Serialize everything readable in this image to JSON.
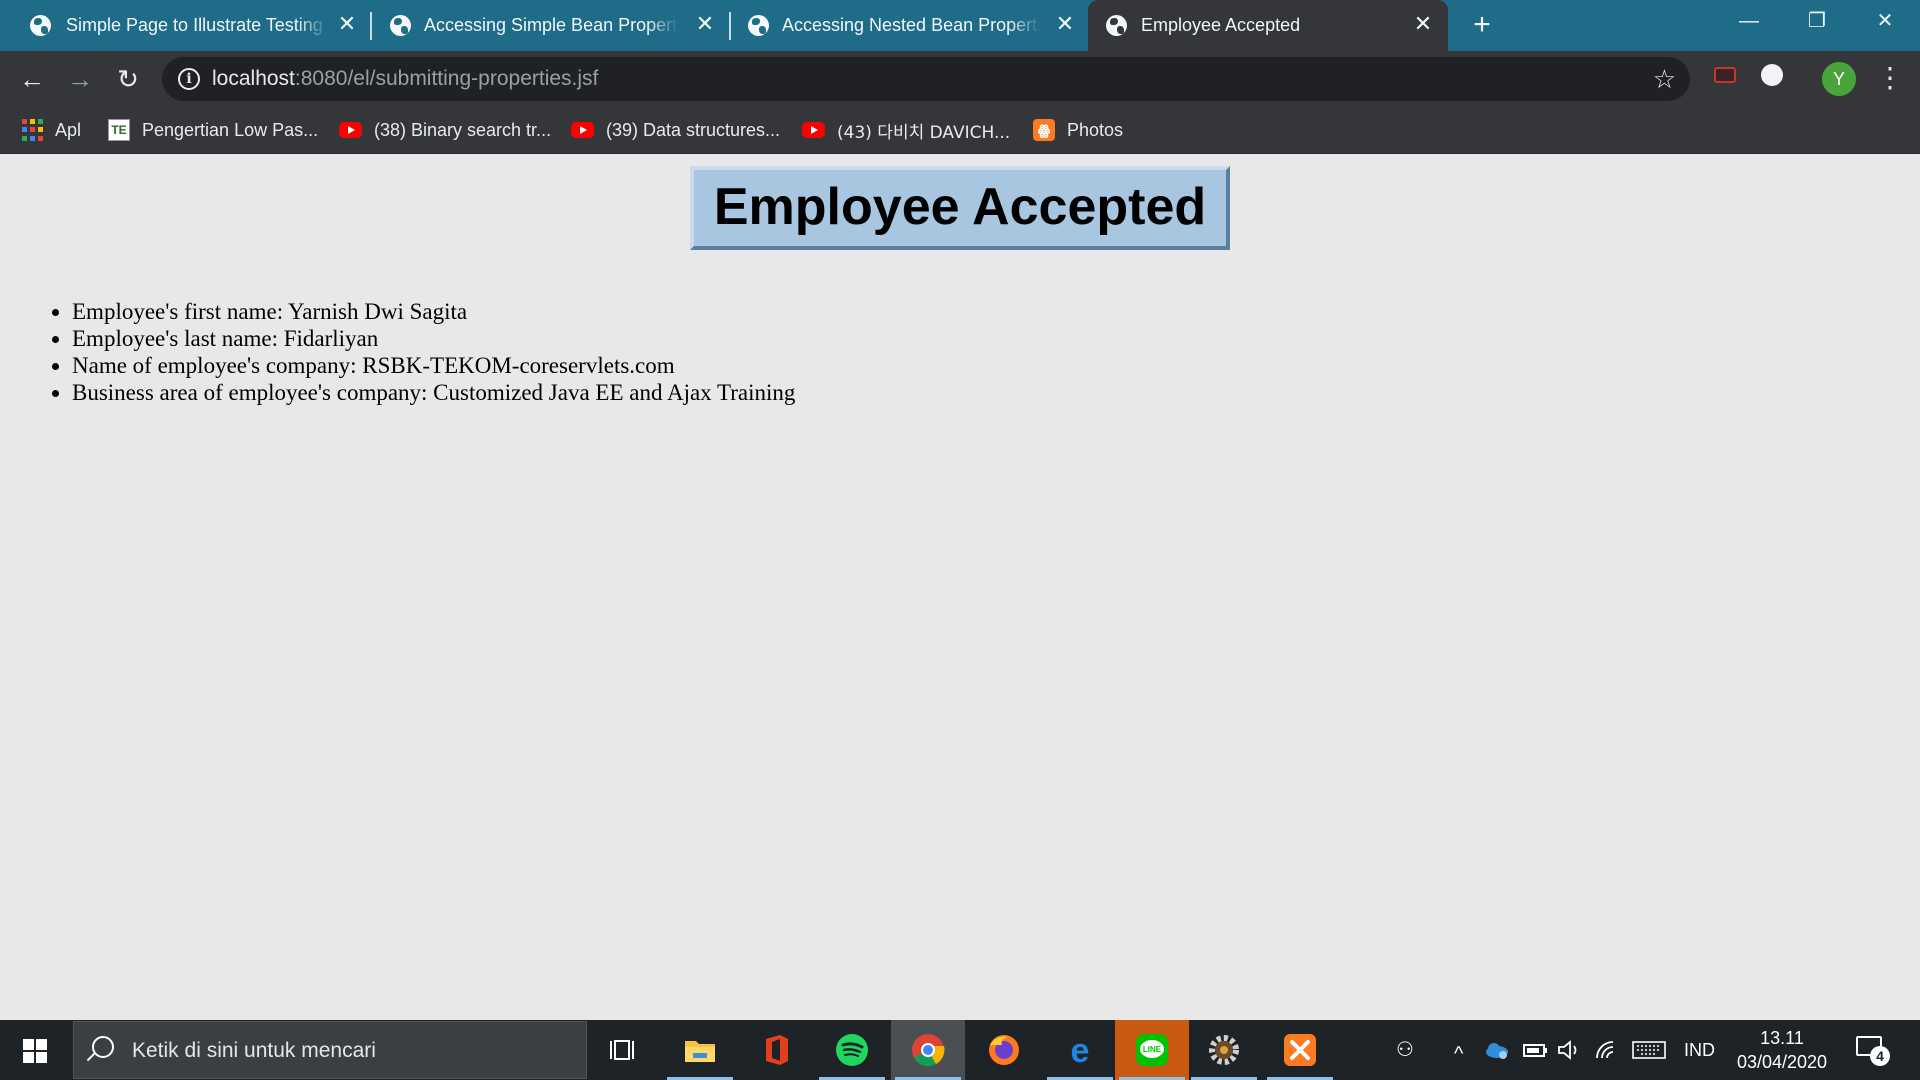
{
  "tabs": [
    {
      "title": "Simple Page to Illustrate Testing F",
      "icon": "globe-icon"
    },
    {
      "title": "Accessing Simple Bean Properties",
      "icon": "globe-icon"
    },
    {
      "title": "Accessing Nested Bean Properties",
      "icon": "globe-icon"
    },
    {
      "title": "Employee Accepted",
      "icon": "globe-icon",
      "active": true
    }
  ],
  "tab_close_glyph": "✕",
  "new_tab_glyph": "+",
  "window_controls": {
    "minimize": "—",
    "restore": "❐",
    "close": "✕"
  },
  "toolbar": {
    "back": "←",
    "forward": "→",
    "reload": "↻",
    "info_glyph": "i",
    "url_host": "localhost",
    "url_path": ":8080/el/submitting-properties.jsf",
    "star": "☆",
    "avatar_letter": "Y",
    "menu": "⋮"
  },
  "bookmarks": [
    {
      "label": "Apl",
      "icon": "apps-grid-icon"
    },
    {
      "label": "Pengertian Low Pas...",
      "icon": "te-favicon",
      "icon_text": "TE"
    },
    {
      "label": "(38) Binary search tr...",
      "icon": "youtube-icon"
    },
    {
      "label": "(39) Data structures...",
      "icon": "youtube-icon"
    },
    {
      "label": "(43) 다비치 DAVICH...",
      "icon": "youtube-icon"
    },
    {
      "label": "Photos",
      "icon": "xampp-icon",
      "icon_text": "ꙮ"
    }
  ],
  "page": {
    "heading": "Employee Accepted",
    "items": [
      "Employee's first name: Yarnish Dwi Sagita",
      "Employee's last name: Fidarliyan",
      "Name of employee's company: RSBK-TEKOM-coreservlets.com",
      "Business area of employee's company: Customized Java EE and Ajax Training"
    ]
  },
  "taskbar": {
    "search_placeholder": "Ketik di sini untuk mencari",
    "apps": [
      "task-view",
      "file-explorer",
      "office",
      "spotify",
      "chrome",
      "firefox",
      "edge",
      "line",
      "settings-app",
      "xampp"
    ],
    "tray": {
      "people": "⚇",
      "chevron": "^",
      "language": "IND"
    },
    "clock_time": "13.11",
    "clock_date": "03/04/2020",
    "notification_count": "4"
  },
  "colors": {
    "tabstrip": "#1f6c88",
    "toolbar": "#35363a",
    "page_bg": "#e8e8e8",
    "heading_box": "#a8c6e0",
    "taskbar": "#1d2327"
  }
}
